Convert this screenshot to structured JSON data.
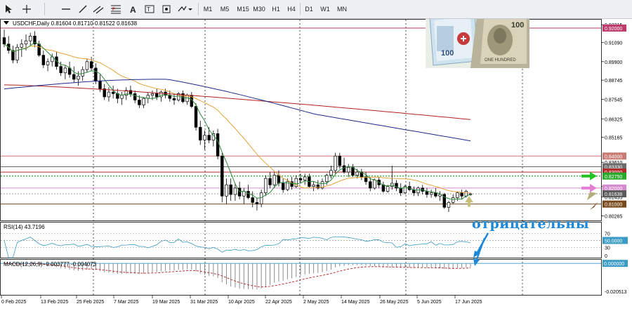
{
  "toolbar": {
    "timeframes": [
      "M1",
      "M5",
      "M15",
      "M30",
      "H1",
      "H4",
      "D1",
      "W1",
      "MN"
    ]
  },
  "chart_info": "USDCHF,Daily  0.81604 0.81710 0.81522 0.81638",
  "rsi_label": "RSI(14) 43.7196",
  "macd_label": "MACD(12,26,9) -0.003777 -0.004073",
  "annotation": "отрицательны",
  "colors": {
    "bull_candle": "#ffffff",
    "bear_candle": "#000000",
    "ma_short": "#2e8b3a",
    "ma_mid": "#e6a33a",
    "ma_long_red": "#b22222",
    "ma_long_blue": "#1f2a8a",
    "rsi_line": "#3a9bc4",
    "macd_signal": "#b22222",
    "annotation": "#1e88d8"
  },
  "price_axis": {
    "ticks": [
      "0.92215",
      "0.91090",
      "0.89900",
      "0.88745",
      "0.87545",
      "0.86325",
      "0.85165",
      "0.83610",
      "0.82095",
      "0.81455",
      "0.80265"
    ]
  },
  "level_labels": [
    {
      "text": "0.92000",
      "bg": "#c03a6c"
    },
    {
      "text": "0.84000",
      "bg": "#c97b73"
    },
    {
      "text": "0.83330",
      "bg": "#6b6b6b"
    },
    {
      "text": "0.83000",
      "bg": "#b52b2b"
    },
    {
      "text": "0.82750",
      "bg": "#2aa82a"
    },
    {
      "text": "0.82000",
      "bg": "#d58ccf"
    },
    {
      "text": "0.81638",
      "bg": "#5a5a5a"
    },
    {
      "text": "0.81000",
      "bg": "#7a4a1e"
    }
  ],
  "rsi_axis": {
    "ticks": [
      "70",
      "50.0000",
      "30",
      "0"
    ]
  },
  "macd_axis": {
    "ticks": [
      "0.000000",
      "-0.020513"
    ]
  },
  "time_axis": {
    "labels": [
      "0 Feb 2025",
      "13 Feb 2025",
      "25 Feb 2025",
      "7 Mar 2025",
      "19 Mar 2025",
      "31 Mar 2025",
      "10 Apr 2025",
      "22 Apr 2025",
      "2 May 2025",
      "14 May 2025",
      "26 May 2025",
      "5 Jun 2025",
      "17 Jun 2025"
    ]
  },
  "chart_data": {
    "type": "candlestick",
    "symbol": "USDCHF",
    "timeframe": "Daily",
    "last_ohlc": {
      "open": 0.81604,
      "high": 0.8171,
      "low": 0.81522,
      "close": 0.81638
    },
    "candles": [
      [
        0.914,
        0.919,
        0.908,
        0.91
      ],
      [
        0.91,
        0.915,
        0.904,
        0.906
      ],
      [
        0.906,
        0.909,
        0.898,
        0.9
      ],
      [
        0.9,
        0.91,
        0.898,
        0.908
      ],
      [
        0.908,
        0.913,
        0.902,
        0.91
      ],
      [
        0.91,
        0.916,
        0.906,
        0.912
      ],
      [
        0.912,
        0.917,
        0.909,
        0.915
      ],
      [
        0.915,
        0.918,
        0.908,
        0.91
      ],
      [
        0.91,
        0.912,
        0.902,
        0.903
      ],
      [
        0.903,
        0.906,
        0.895,
        0.897
      ],
      [
        0.897,
        0.901,
        0.893,
        0.899
      ],
      [
        0.899,
        0.904,
        0.896,
        0.902
      ],
      [
        0.902,
        0.905,
        0.894,
        0.896
      ],
      [
        0.896,
        0.899,
        0.89,
        0.892
      ],
      [
        0.892,
        0.897,
        0.888,
        0.895
      ],
      [
        0.895,
        0.899,
        0.889,
        0.891
      ],
      [
        0.891,
        0.896,
        0.886,
        0.888
      ],
      [
        0.888,
        0.893,
        0.884,
        0.89
      ],
      [
        0.89,
        0.896,
        0.887,
        0.894
      ],
      [
        0.894,
        0.901,
        0.892,
        0.899
      ],
      [
        0.899,
        0.902,
        0.893,
        0.895
      ],
      [
        0.895,
        0.898,
        0.885,
        0.887
      ],
      [
        0.887,
        0.891,
        0.88,
        0.882
      ],
      [
        0.882,
        0.885,
        0.875,
        0.877
      ],
      [
        0.877,
        0.883,
        0.874,
        0.88
      ],
      [
        0.88,
        0.884,
        0.876,
        0.879
      ],
      [
        0.879,
        0.882,
        0.873,
        0.876
      ],
      [
        0.876,
        0.88,
        0.872,
        0.878
      ],
      [
        0.878,
        0.883,
        0.875,
        0.881
      ],
      [
        0.881,
        0.884,
        0.877,
        0.879
      ],
      [
        0.879,
        0.881,
        0.873,
        0.875
      ],
      [
        0.875,
        0.878,
        0.87,
        0.872
      ],
      [
        0.872,
        0.877,
        0.87,
        0.876
      ],
      [
        0.876,
        0.88,
        0.873,
        0.878
      ],
      [
        0.878,
        0.881,
        0.875,
        0.879
      ],
      [
        0.879,
        0.882,
        0.875,
        0.877
      ],
      [
        0.877,
        0.881,
        0.874,
        0.88
      ],
      [
        0.88,
        0.882,
        0.876,
        0.878
      ],
      [
        0.878,
        0.881,
        0.874,
        0.876
      ],
      [
        0.876,
        0.879,
        0.872,
        0.875
      ],
      [
        0.875,
        0.88,
        0.874,
        0.879
      ],
      [
        0.879,
        0.881,
        0.873,
        0.874
      ],
      [
        0.874,
        0.879,
        0.872,
        0.878
      ],
      [
        0.878,
        0.88,
        0.87,
        0.871
      ],
      [
        0.871,
        0.873,
        0.856,
        0.858
      ],
      [
        0.858,
        0.862,
        0.847,
        0.85
      ],
      [
        0.85,
        0.856,
        0.844,
        0.853
      ],
      [
        0.853,
        0.858,
        0.848,
        0.85
      ],
      [
        0.85,
        0.856,
        0.846,
        0.854
      ],
      [
        0.854,
        0.857,
        0.838,
        0.84
      ],
      [
        0.84,
        0.842,
        0.811,
        0.815
      ],
      [
        0.815,
        0.826,
        0.81,
        0.822
      ],
      [
        0.822,
        0.826,
        0.812,
        0.816
      ],
      [
        0.816,
        0.823,
        0.812,
        0.82
      ],
      [
        0.82,
        0.824,
        0.813,
        0.815
      ],
      [
        0.815,
        0.82,
        0.81,
        0.818
      ],
      [
        0.818,
        0.822,
        0.813,
        0.814
      ],
      [
        0.814,
        0.818,
        0.808,
        0.811
      ],
      [
        0.811,
        0.814,
        0.806,
        0.81
      ],
      [
        0.81,
        0.819,
        0.808,
        0.817
      ],
      [
        0.817,
        0.828,
        0.815,
        0.826
      ],
      [
        0.826,
        0.83,
        0.82,
        0.822
      ],
      [
        0.822,
        0.83,
        0.82,
        0.828
      ],
      [
        0.828,
        0.831,
        0.821,
        0.823
      ],
      [
        0.823,
        0.826,
        0.817,
        0.819
      ],
      [
        0.819,
        0.826,
        0.818,
        0.824
      ],
      [
        0.824,
        0.827,
        0.819,
        0.821
      ],
      [
        0.821,
        0.828,
        0.82,
        0.826
      ],
      [
        0.826,
        0.829,
        0.823,
        0.825
      ],
      [
        0.825,
        0.829,
        0.822,
        0.827
      ],
      [
        0.827,
        0.829,
        0.82,
        0.821
      ],
      [
        0.821,
        0.824,
        0.818,
        0.822
      ],
      [
        0.822,
        0.825,
        0.819,
        0.82
      ],
      [
        0.82,
        0.826,
        0.819,
        0.824
      ],
      [
        0.824,
        0.829,
        0.822,
        0.828
      ],
      [
        0.828,
        0.834,
        0.826,
        0.831
      ],
      [
        0.831,
        0.842,
        0.829,
        0.84
      ],
      [
        0.84,
        0.842,
        0.832,
        0.834
      ],
      [
        0.834,
        0.839,
        0.829,
        0.83
      ],
      [
        0.83,
        0.835,
        0.827,
        0.833
      ],
      [
        0.833,
        0.835,
        0.827,
        0.828
      ],
      [
        0.828,
        0.832,
        0.826,
        0.83
      ],
      [
        0.83,
        0.832,
        0.825,
        0.827
      ],
      [
        0.827,
        0.83,
        0.822,
        0.824
      ],
      [
        0.824,
        0.827,
        0.818,
        0.82
      ],
      [
        0.82,
        0.826,
        0.819,
        0.825
      ],
      [
        0.825,
        0.827,
        0.82,
        0.822
      ],
      [
        0.822,
        0.824,
        0.817,
        0.818
      ],
      [
        0.818,
        0.822,
        0.817,
        0.821
      ],
      [
        0.821,
        0.834,
        0.819,
        0.823
      ],
      [
        0.823,
        0.825,
        0.818,
        0.82
      ],
      [
        0.82,
        0.823,
        0.815,
        0.817
      ],
      [
        0.817,
        0.822,
        0.816,
        0.821
      ],
      [
        0.821,
        0.824,
        0.818,
        0.819
      ],
      [
        0.819,
        0.821,
        0.815,
        0.817
      ],
      [
        0.817,
        0.821,
        0.815,
        0.82
      ],
      [
        0.82,
        0.822,
        0.816,
        0.818
      ],
      [
        0.818,
        0.82,
        0.814,
        0.816
      ],
      [
        0.816,
        0.819,
        0.814,
        0.817
      ],
      [
        0.817,
        0.82,
        0.814,
        0.815
      ],
      [
        0.815,
        0.818,
        0.812,
        0.816
      ],
      [
        0.816,
        0.817,
        0.807,
        0.808
      ],
      [
        0.808,
        0.812,
        0.805,
        0.811
      ],
      [
        0.811,
        0.816,
        0.81,
        0.814
      ],
      [
        0.814,
        0.818,
        0.812,
        0.817
      ],
      [
        0.817,
        0.819,
        0.813,
        0.815
      ],
      [
        0.815,
        0.819,
        0.814,
        0.818
      ],
      [
        0.81604,
        0.8171,
        0.81522,
        0.81638
      ]
    ],
    "horizontal_levels": [
      0.92,
      0.84,
      0.8333,
      0.83,
      0.8275,
      0.82,
      0.81638,
      0.81
    ],
    "rsi": {
      "period": 14,
      "value": 43.7196,
      "levels": [
        70,
        50,
        30
      ]
    },
    "macd": {
      "fast": 12,
      "slow": 26,
      "signal": 9,
      "main": -0.003777,
      "signal_value": -0.004073
    }
  }
}
